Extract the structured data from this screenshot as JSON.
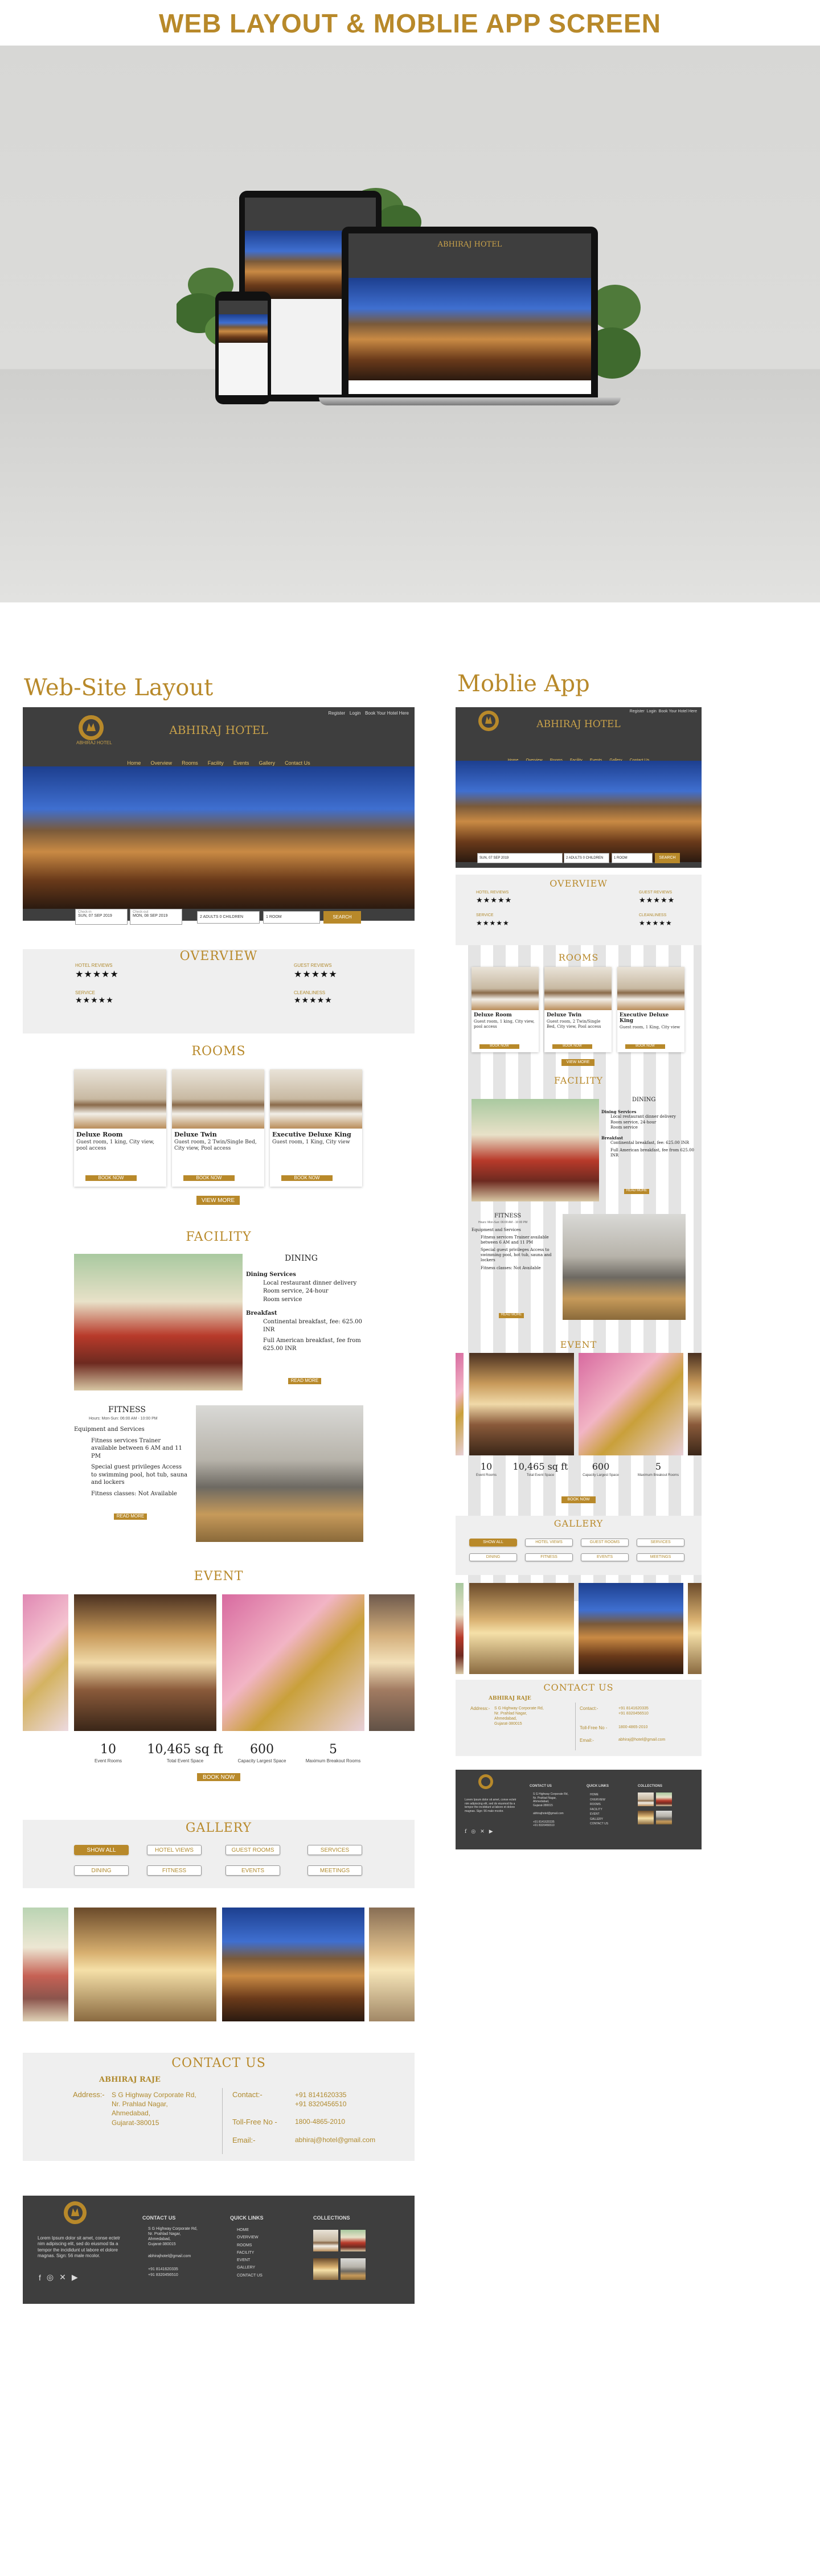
{
  "banner": {
    "title": "WEB LAYOUT &  MOBLIE APP SCREEN"
  },
  "labels": {
    "website": "Web-Site Layout",
    "mobile": "Moblie App"
  },
  "brand": {
    "hotel_name": "ABHIRAJ HOTEL",
    "contact_name": "ABHIRAJ RAJE"
  },
  "colors": {
    "gold": "#b8892a",
    "dark": "#3e3e3e",
    "light_gray": "#efefef"
  },
  "top_bar": {
    "links": [
      "Register",
      "Login",
      "Book Your Hotel Here"
    ]
  },
  "nav": {
    "items": [
      "Home",
      "Overview",
      "Rooms",
      "Facility",
      "Events",
      "Gallery",
      "Contact Us"
    ]
  },
  "booking": {
    "check_in_label": "Check-in",
    "check_in_value": "SUN, 07 SEP 2019",
    "check_out_label": "Check-out",
    "check_out_value": "MON, 08 SEP 2019",
    "guests_value": "2 ADULTS 0 CHILDREN",
    "rooms_value": "1 ROOM",
    "search_label": "SEARCH"
  },
  "overview": {
    "title": "OVERVIEW",
    "ratings": [
      {
        "label": "HOTEL REVIEWS",
        "stars": "★★★★★"
      },
      {
        "label": "GUEST REVIEWS",
        "stars": "★★★★★"
      },
      {
        "label": "SERVICE",
        "stars": "★★★★★"
      },
      {
        "label": "CLEANLINESS",
        "stars": "★★★★★"
      }
    ]
  },
  "rooms": {
    "title": "ROOMS",
    "items": [
      {
        "name": "Deluxe Room",
        "desc": "Guest room, 1 king, City view, pool access",
        "btn": "BOOK NOW"
      },
      {
        "name": "Deluxe Twin",
        "desc": "Guest room, 2 Twin/Single Bed, City view, Pool access",
        "btn": "BOOK NOW"
      },
      {
        "name": "Executive Deluxe King",
        "desc": "Guest room, 1 King, City view",
        "btn": "BOOK NOW"
      }
    ],
    "view_more": "VIEW MORE"
  },
  "facility": {
    "title": "FACILITY",
    "dining": {
      "title": "DINING",
      "services_heading": "Dining Services",
      "services": [
        "Local restaurant dinner delivery",
        "Room service, 24-hour",
        "Room service"
      ],
      "breakfast_heading": "Breakfast",
      "breakfast": [
        "Continental breakfast, fee: 625.00 INR",
        "Full American breakfast, fee from 625.00 INR"
      ],
      "btn": "READ MORE"
    },
    "fitness": {
      "title": "FITNESS",
      "hours": "Hours: Mon-Sun: 06:00 AM - 10:00 PM",
      "equipment_heading": "Equipment and Services",
      "lines": [
        "Fitness services Trainer available between 6 AM and 11 PM",
        "Special guest privileges Access to swimming pool, hot tub, sauna and lockers",
        "Fitness classes: Not Available"
      ],
      "btn": "READ MORE"
    }
  },
  "event": {
    "title": "EVENT",
    "stats": [
      {
        "n": "10",
        "l": "Event Rooms"
      },
      {
        "n": "10,465 sq ft",
        "l": "Total Event Space"
      },
      {
        "n": "600",
        "l": "Capacity Largest Space"
      },
      {
        "n": "5",
        "l": "Maximum Breakout Rooms"
      }
    ],
    "btn": "BOOK NOW"
  },
  "gallery": {
    "title": "GALLERY",
    "filters": [
      "SHOW ALL",
      "HOTEL VIEWS",
      "GUEST ROOMS",
      "SERVICES",
      "DINING",
      "FITNESS",
      "EVENTS",
      "MEETINGS"
    ]
  },
  "contact": {
    "title": "CONTACT US",
    "address_label": "Address:-",
    "address_lines": [
      "S G Highway Corporate Rd,",
      "Nr. Prahlad Nagar,",
      "Ahmedabad,",
      "Gujarat-380015"
    ],
    "contact_label": "Contact:-",
    "phones": [
      "+91 8141620335",
      "+91 8320456510"
    ],
    "tollfree_label": "Toll-Free No -",
    "tollfree": "1800-4865-2010",
    "email_label": "Email:-",
    "email": "abhiraj@hotel@gmail.com"
  },
  "footer": {
    "about": "Lorem Ipsum dolor sit amet, conse ectetr nim adipiscing elit, sed do eiusmod tla a tempor the incididunt ut labore et dolore magnas. Sign: 56 male mcolor.",
    "contact_heading": "CONTACT US",
    "contact_lines": [
      "S G Highway Corporate Rd,",
      "Nr. Prahlad Nagar,",
      "Ahmedabad,",
      "Gujarat-380015"
    ],
    "contact_email": "abhirajhotel@gmail.com",
    "contact_phones": [
      "+91 8141620335",
      "+91 8320456510"
    ],
    "quick_heading": "QUICK LINKS",
    "quick_links": [
      "HOME",
      "OVERVIEW",
      "ROOMS",
      "FACILITY",
      "EVENT",
      "GALLERY",
      "CONTACT US"
    ],
    "collections_heading": "COLLECTIONS"
  }
}
